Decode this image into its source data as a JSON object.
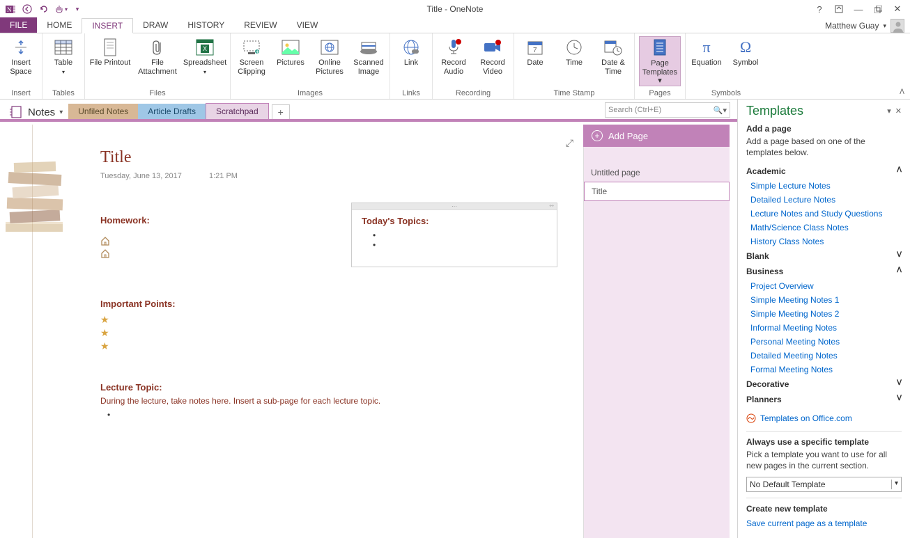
{
  "app_title": "Title - OneNote",
  "user_name": "Matthew Guay",
  "ribbon_tabs": {
    "file": "FILE",
    "home": "HOME",
    "insert": "INSERT",
    "draw": "DRAW",
    "history": "HISTORY",
    "review": "REVIEW",
    "view": "VIEW"
  },
  "ribbon": {
    "groups": {
      "insert": "Insert",
      "tables": "Tables",
      "files": "Files",
      "images": "Images",
      "links": "Links",
      "recording": "Recording",
      "timestamp": "Time Stamp",
      "pages": "Pages",
      "symbols": "Symbols"
    },
    "buttons": {
      "insert_space": "Insert Space",
      "table": "Table",
      "file_printout": "File Printout",
      "file_attachment": "File Attachment",
      "spreadsheet": "Spreadsheet",
      "screen_clipping": "Screen Clipping",
      "pictures": "Pictures",
      "online_pictures": "Online Pictures",
      "scanned_image": "Scanned Image",
      "link": "Link",
      "record_audio": "Record Audio",
      "record_video": "Record Video",
      "date": "Date",
      "time": "Time",
      "date_time": "Date & Time",
      "page_templates": "Page Templates ▾",
      "equation": "Equation",
      "symbol": "Symbol"
    }
  },
  "notebook": "Notes",
  "sections": {
    "unfiled": {
      "label": "Unfiled Notes",
      "color": "#d8b896"
    },
    "drafts": {
      "label": "Article Drafts",
      "color": "#9fc7e6"
    },
    "scratch": {
      "label": "Scratchpad",
      "color": "#c182b8"
    }
  },
  "search_placeholder": "Search (Ctrl+E)",
  "add_page_label": "Add Page",
  "pages": {
    "untitled": "Untitled page",
    "title": "Title"
  },
  "note": {
    "title": "Title",
    "date": "Tuesday, June 13, 2017",
    "time": "1:21 PM",
    "homework": "Homework:",
    "important": "Important Points:",
    "lecture": "Lecture Topic:",
    "lecture_body": "During the lecture, take notes here.  Insert a sub-page for each lecture topic.",
    "topics": "Today's Topics:"
  },
  "templates": {
    "title": "Templates",
    "add_page": "Add a page",
    "add_help": "Add a page based on one of the templates below.",
    "cat_academic": "Academic",
    "academic": [
      "Simple Lecture Notes",
      "Detailed Lecture Notes",
      "Lecture Notes and Study Questions",
      "Math/Science Class Notes",
      "History Class Notes"
    ],
    "cat_blank": "Blank",
    "cat_business": "Business",
    "business": [
      "Project Overview",
      "Simple Meeting Notes 1",
      "Simple Meeting Notes 2",
      "Informal Meeting Notes",
      "Personal Meeting Notes",
      "Detailed Meeting Notes",
      "Formal Meeting Notes"
    ],
    "cat_decorative": "Decorative",
    "cat_planners": "Planners",
    "office_link": "Templates on Office.com",
    "always": "Always use a specific template",
    "always_help": "Pick a template you want to use for all new pages in the current section.",
    "default_template": "No Default Template",
    "create_new": "Create new template",
    "save_current": "Save current page as a template"
  }
}
